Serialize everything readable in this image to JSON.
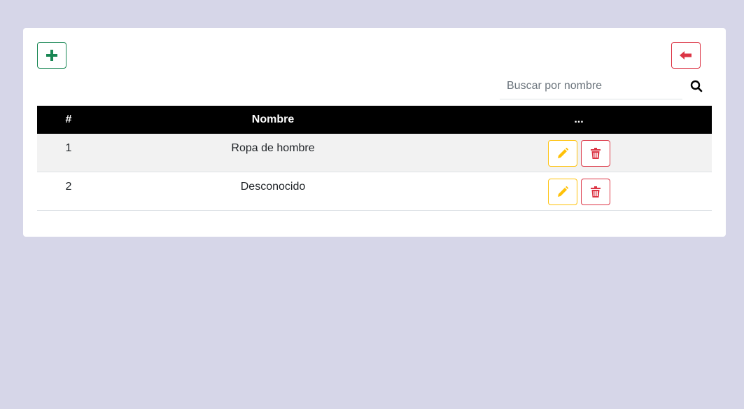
{
  "toolbar": {
    "add_icon": "plus-icon",
    "back_icon": "arrow-left-icon"
  },
  "search": {
    "placeholder": "Buscar por nombre",
    "value": "",
    "icon": "search-icon"
  },
  "table": {
    "headers": [
      "#",
      "Nombre",
      "..."
    ],
    "rows": [
      {
        "id": "1",
        "name": "Ropa de hombre"
      },
      {
        "id": "2",
        "name": "Desconocido"
      }
    ],
    "edit_icon": "pencil-icon",
    "delete_icon": "trash-icon"
  },
  "colors": {
    "background": "#d6d6e8",
    "add": "#198754",
    "back": "#dc3545",
    "edit": "#ffc107",
    "delete": "#dc3545",
    "header": "#000000"
  }
}
